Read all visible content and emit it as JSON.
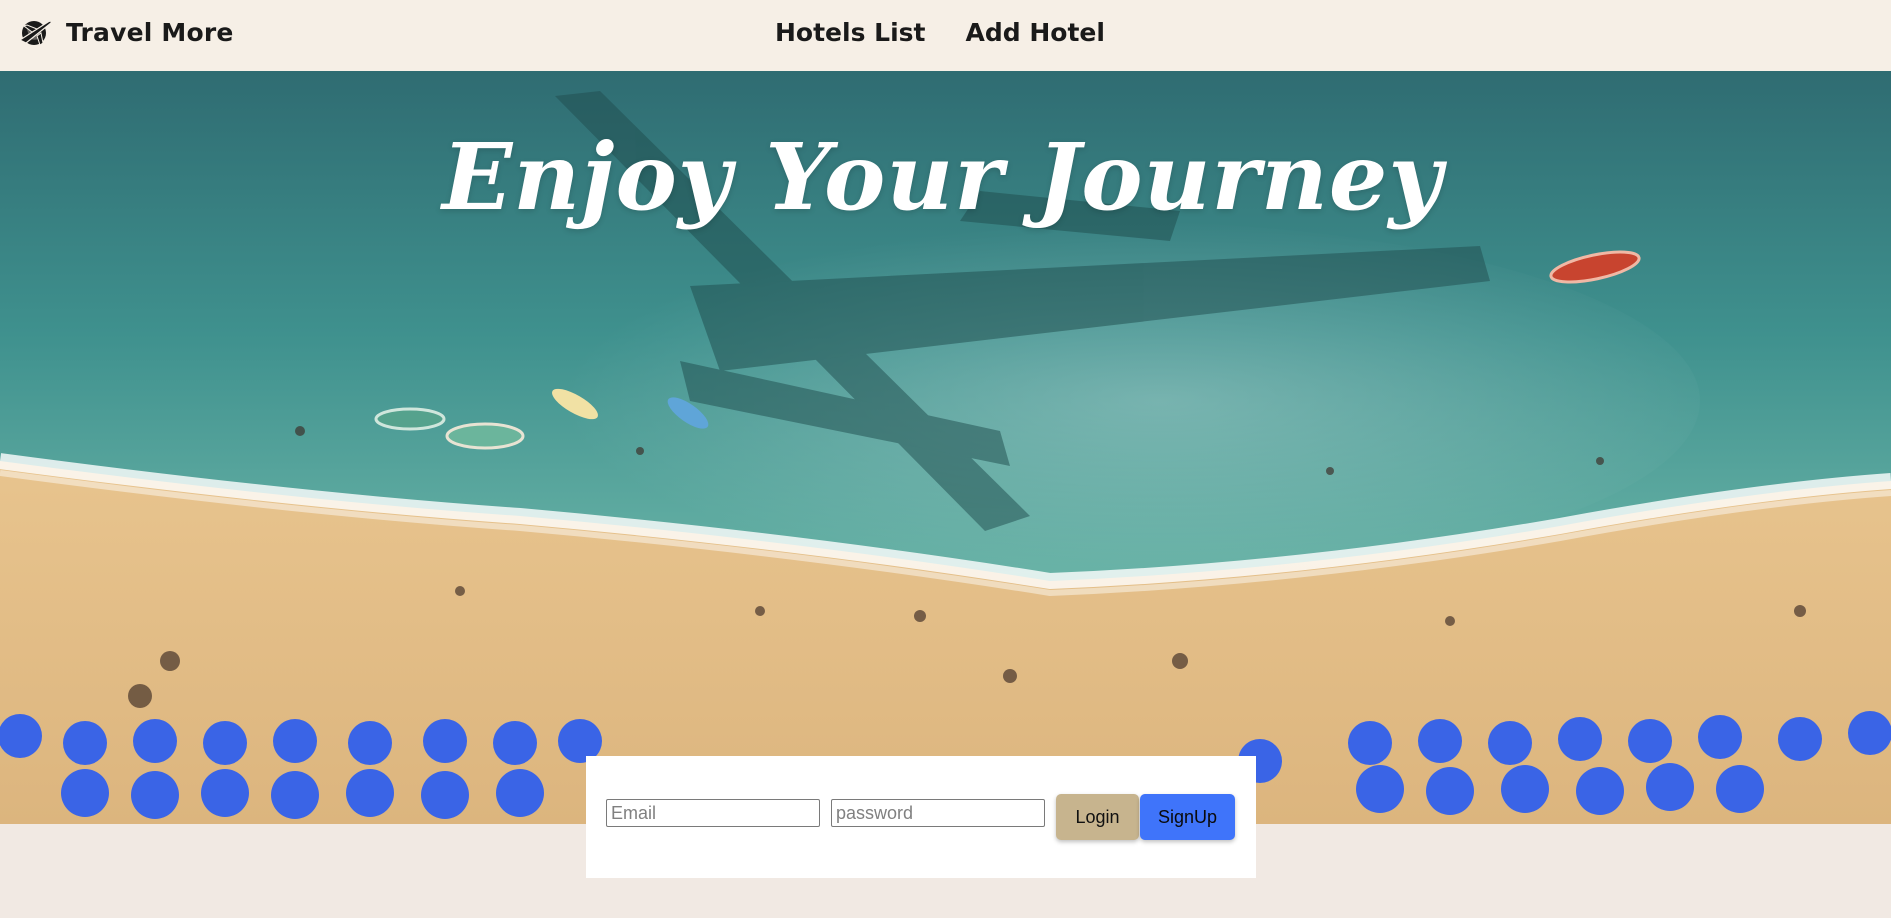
{
  "navbar": {
    "brand_name": "Travel More",
    "links": [
      {
        "label": "Hotels List"
      },
      {
        "label": "Add Hotel"
      }
    ]
  },
  "hero": {
    "title": "Enjoy Your Journey"
  },
  "login_form": {
    "email_placeholder": "Email",
    "password_placeholder": "password",
    "login_label": "Login",
    "signup_label": "SignUp"
  },
  "colors": {
    "navbar_bg": "#f6efe6",
    "page_bg": "#f1e9e3",
    "login_button": "#c7b48e",
    "signup_button": "#3f74fa"
  }
}
